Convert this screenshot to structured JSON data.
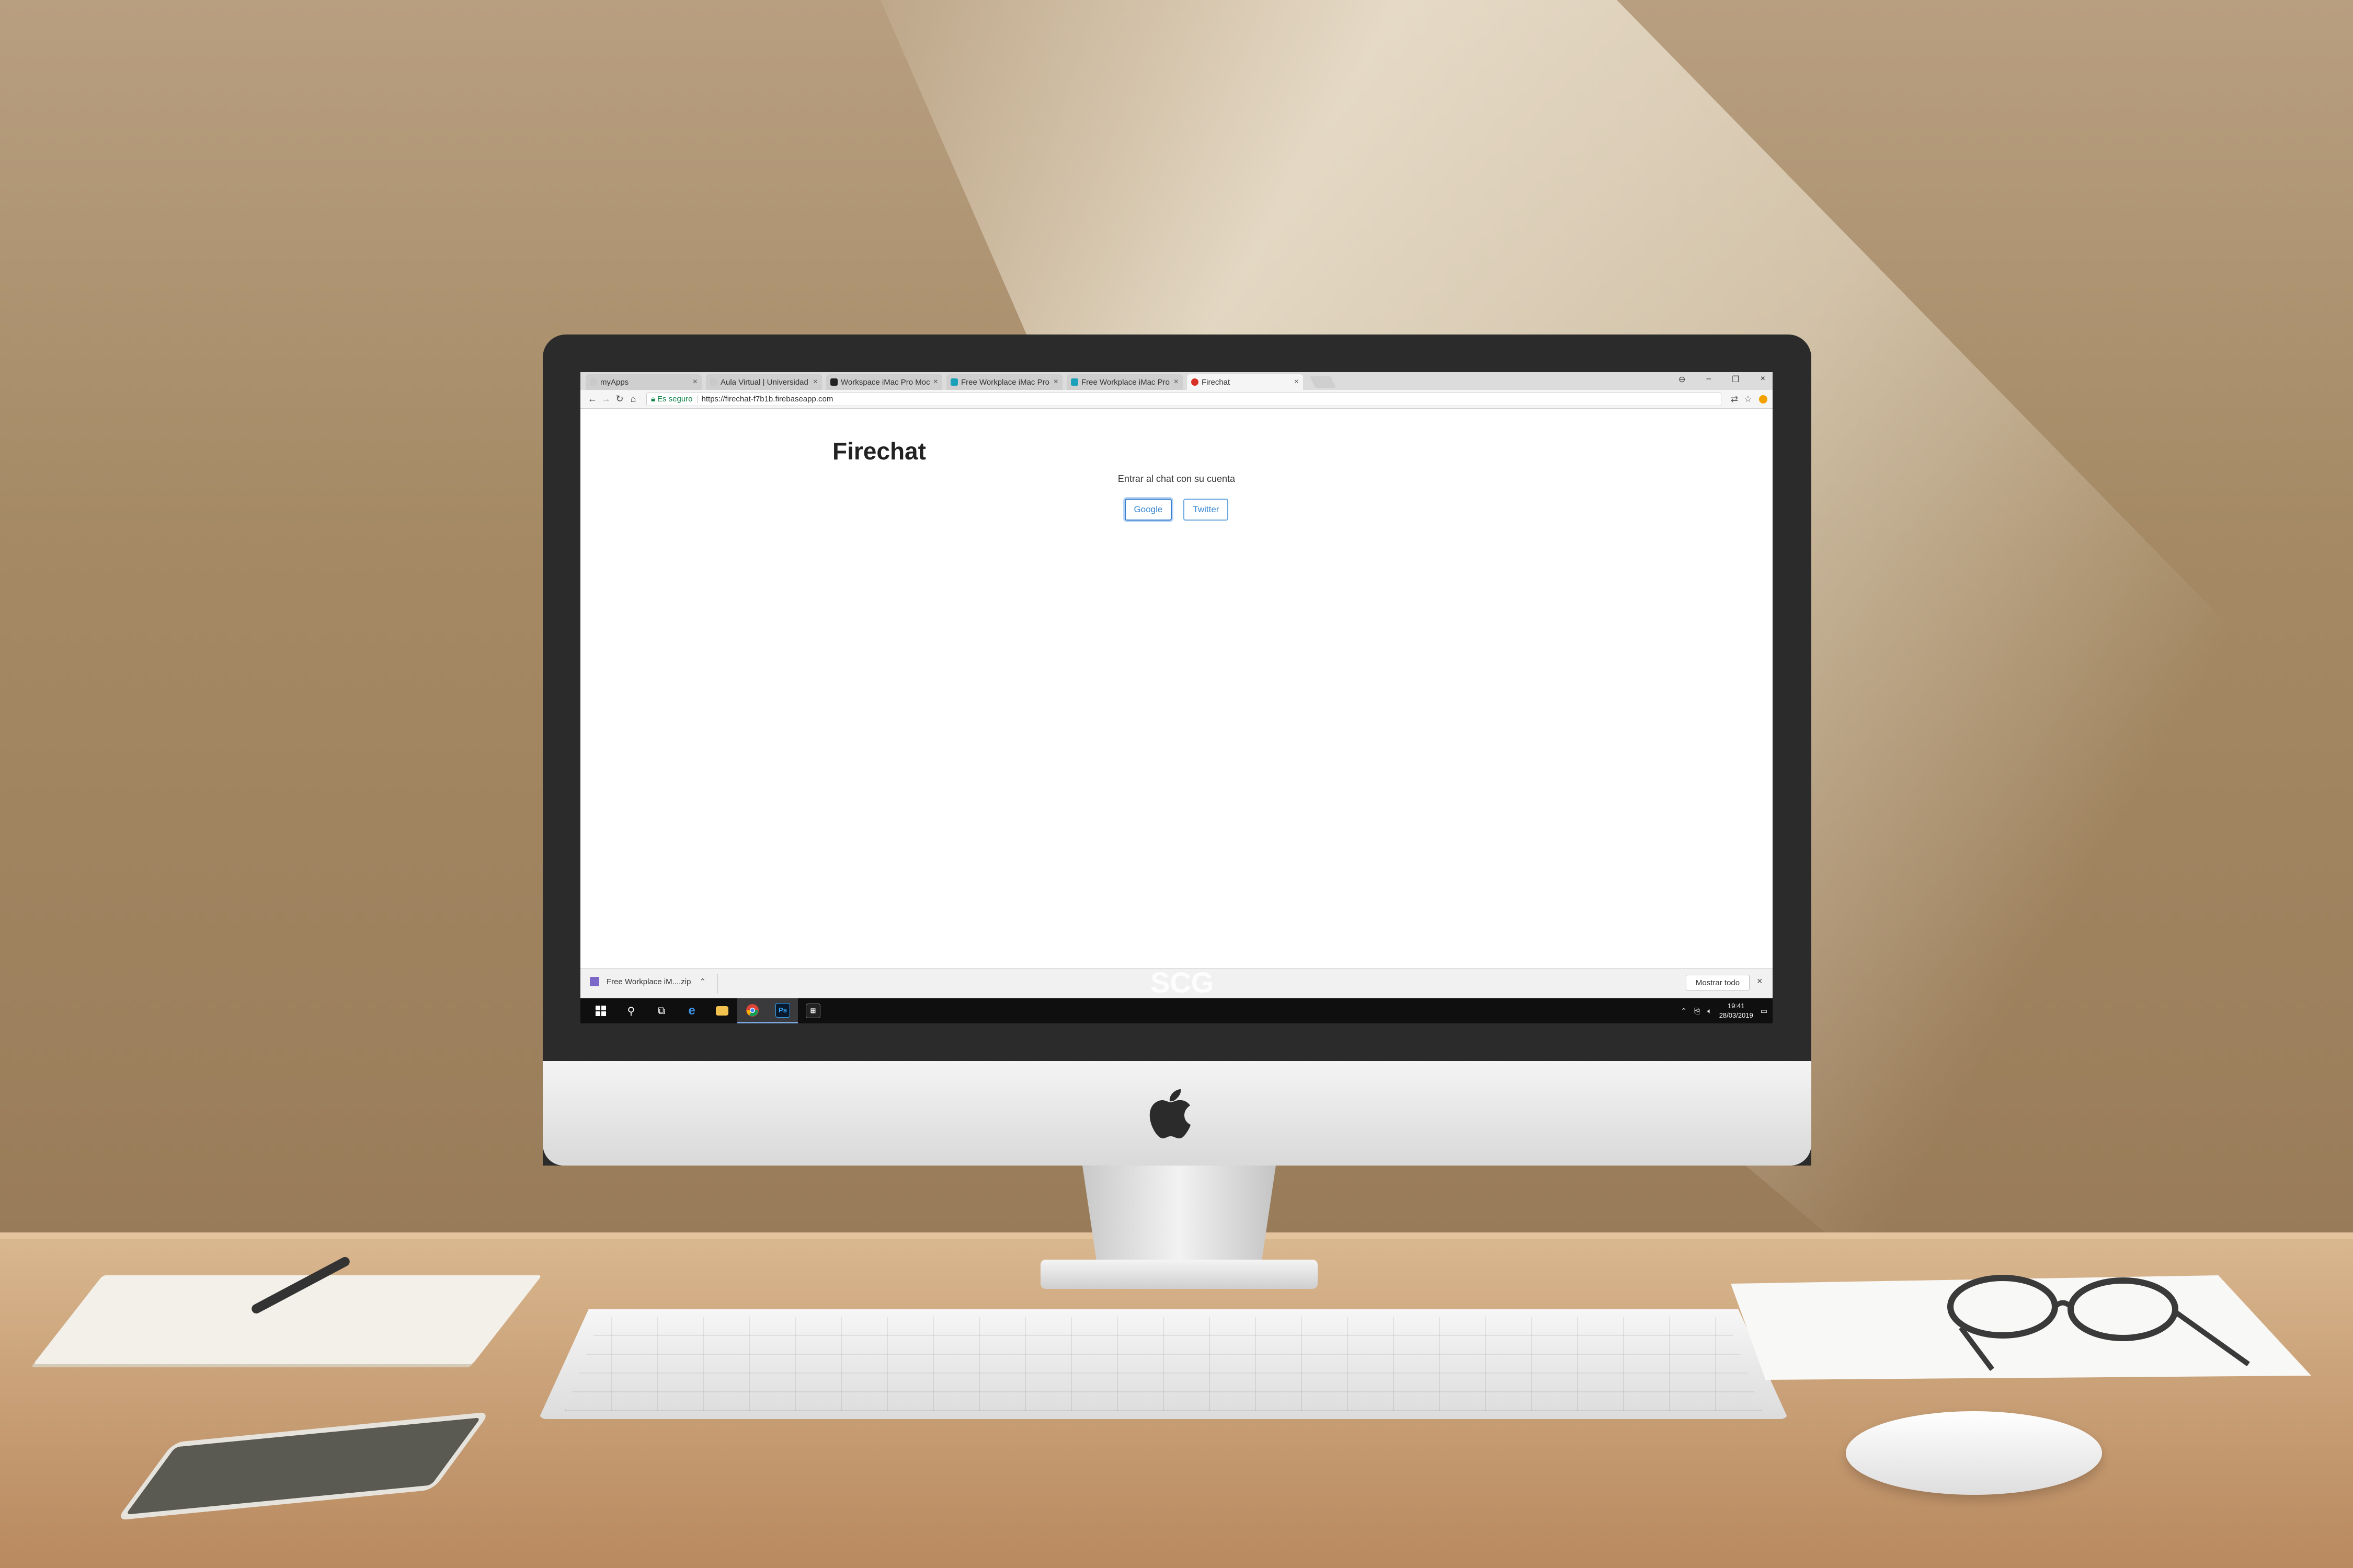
{
  "browser": {
    "tabs": [
      {
        "label": "myApps",
        "favicon_color": "#c9c9c9",
        "active": false
      },
      {
        "label": "Aula Virtual | Universidad",
        "favicon_color": "#c9c9c9",
        "active": false
      },
      {
        "label": "Workspace iMac Pro Mock",
        "favicon_color": "#222222",
        "active": false
      },
      {
        "label": "Free Workplace iMac Pro",
        "favicon_color": "#1aa0b8",
        "active": false
      },
      {
        "label": "Free Workplace iMac Pro",
        "favicon_color": "#1aa0b8",
        "active": false
      },
      {
        "label": "Firechat",
        "favicon_color": "#d93025",
        "active": true
      }
    ],
    "tab_close_glyph": "×",
    "window_controls": {
      "account": "⊖",
      "minimize": "–",
      "restore": "❐",
      "close": "×"
    },
    "address_bar": {
      "secure_label": "Es seguro",
      "url": "https://firechat-f7b1b.firebaseapp.com"
    }
  },
  "page": {
    "title": "Firechat",
    "subtitle": "Entrar al chat con su cuenta",
    "buttons": {
      "google": "Google",
      "twitter": "Twitter"
    },
    "watermark": "SCG"
  },
  "download_bar": {
    "file_label": "Free Workplace iM....zip",
    "show_all_label": "Mostrar todo"
  },
  "taskbar": {
    "time": "19:41",
    "date": "28/03/2019"
  },
  "colors": {
    "accent_blue": "#3a88d0",
    "secure_green": "#0b8043",
    "taskbar_bg": "#0f0f10"
  }
}
